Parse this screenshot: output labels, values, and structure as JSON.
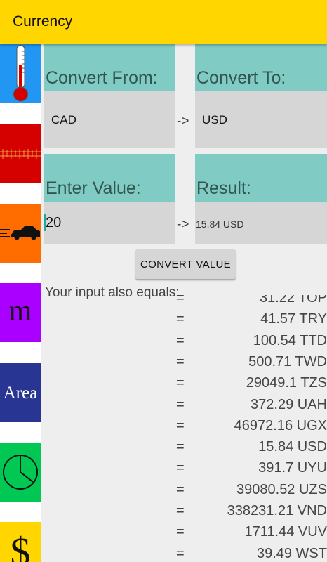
{
  "app_bar": {
    "title": "Currency"
  },
  "colors": {
    "app_bar": "#ffd600",
    "card_header": "#80cbc4",
    "card_body": "#d6d6d6",
    "background": "#eeeeee"
  },
  "sidebar": {
    "items": [
      {
        "name": "thermometer-icon",
        "color": "#2196f3"
      },
      {
        "name": "ruler-icon",
        "color": "#d50000"
      },
      {
        "name": "car-icon",
        "color": "#ff6d00"
      },
      {
        "name": "mass-icon",
        "label": "m",
        "color": "#aa00ff"
      },
      {
        "name": "area-icon",
        "label": "Area",
        "color": "#283593"
      },
      {
        "name": "clock-icon",
        "color": "#00c853"
      },
      {
        "name": "dollar-icon",
        "label": "$",
        "color": "#ffd600"
      }
    ]
  },
  "converter": {
    "from_label": "Convert From:",
    "to_label": "Convert To:",
    "from_currency": "CAD",
    "to_currency": "USD",
    "arrow": "->",
    "enter_label": "Enter Value:",
    "result_label": "Result:",
    "input_value": "20",
    "result_value": "15.84 USD",
    "button_label": "CONVERT VALUE"
  },
  "equivalents": {
    "label": "Your input also equals:",
    "equals_sign": "=",
    "rows": [
      {
        "amount": "31.22 TOP"
      },
      {
        "amount": "41.57 TRY"
      },
      {
        "amount": "100.54 TTD"
      },
      {
        "amount": "500.71 TWD"
      },
      {
        "amount": "29049.1 TZS"
      },
      {
        "amount": "372.29 UAH"
      },
      {
        "amount": "46972.16 UGX"
      },
      {
        "amount": "15.84 USD"
      },
      {
        "amount": "391.7 UYU"
      },
      {
        "amount": "39080.52 UZS"
      },
      {
        "amount": "338231.21 VND"
      },
      {
        "amount": "1711.44 VUV"
      },
      {
        "amount": "39.49 WST"
      }
    ]
  }
}
